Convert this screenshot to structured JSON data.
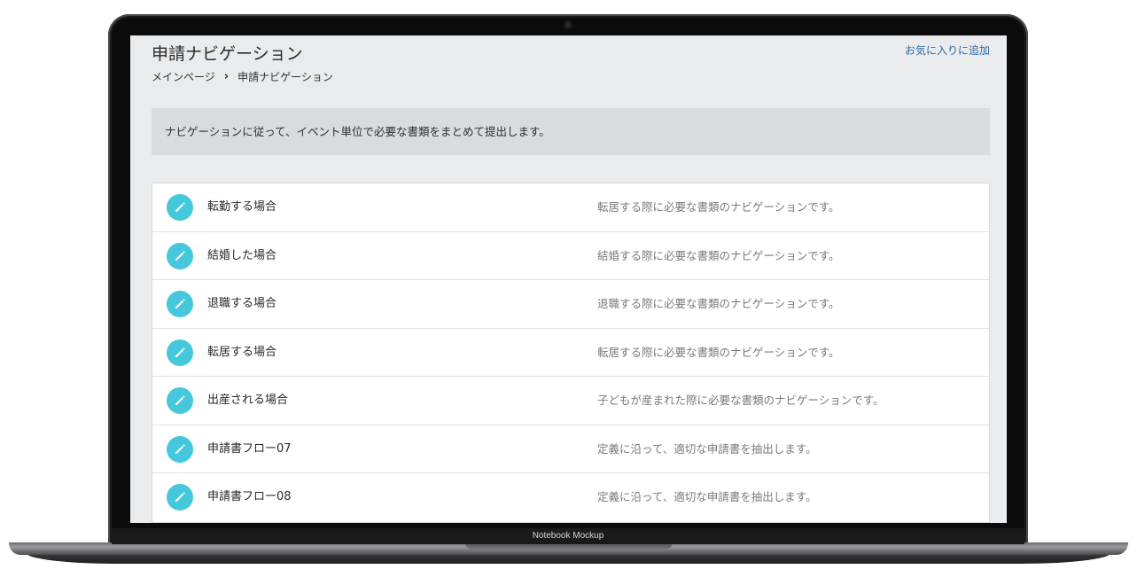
{
  "header": {
    "title": "申請ナビゲーション",
    "favorite_link": "お気に入りに追加"
  },
  "breadcrumb": {
    "home": "メインページ",
    "separator_icon": "chevron-right-icon",
    "current": "申請ナビゲーション"
  },
  "info": {
    "message": "ナビゲーションに従って、イベント単位で必要な書類をまとめて提出します。"
  },
  "navigation_list": {
    "item_icon": "pencil-icon",
    "icon_color": "#45c8dc",
    "items": [
      {
        "label": "転勤する場合",
        "description": "転居する際に必要な書類のナビゲーションです。"
      },
      {
        "label": "結婚した場合",
        "description": "結婚する際に必要な書類のナビゲーションです。"
      },
      {
        "label": "退職する場合",
        "description": "退職する際に必要な書類のナビゲーションです。"
      },
      {
        "label": "転居する場合",
        "description": "転居する際に必要な書類のナビゲーションです。"
      },
      {
        "label": "出産される場合",
        "description": "子どもが産まれた際に必要な書類のナビゲーションです。"
      },
      {
        "label": "申請書フロー07",
        "description": "定義に沿って、適切な申請書を抽出します。"
      },
      {
        "label": "申請書フロー08",
        "description": "定義に沿って、適切な申請書を抽出します。"
      }
    ]
  },
  "device": {
    "bezel_label": "Notebook Mockup"
  }
}
